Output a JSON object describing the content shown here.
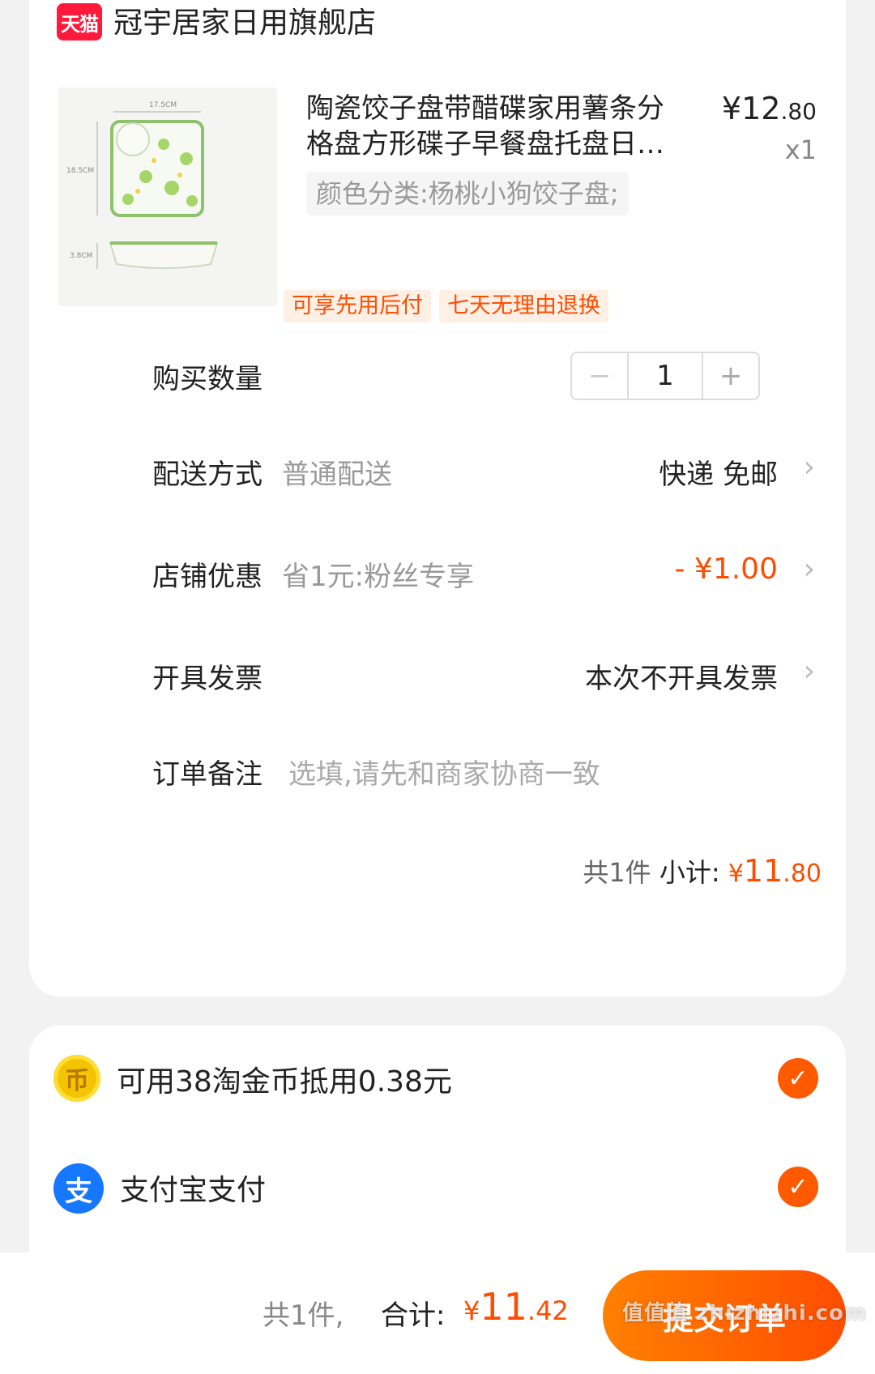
{
  "shop": {
    "platform_logo": "天猫",
    "name": "冠宇居家日用旗舰店",
    "brand_color": "#ff1a3c"
  },
  "product": {
    "image_icon": "ceramic-dumpling-plate-image",
    "image_labels": {
      "width": "17.5CM",
      "height": "18.5CM",
      "depth": "3.8CM"
    },
    "title": "陶瓷饺子盘带醋碟家用薯条分格盘方形碟子早餐盘托盘日…",
    "price_currency": "¥",
    "price_int": "12",
    "price_dec": ".80",
    "quantity": "x1",
    "spec": "颜色分类:杨桃小狗饺子盘;",
    "tags": [
      "可享先用后付",
      "七天无理由退换"
    ]
  },
  "rows": {
    "quantity": {
      "label": "购买数量",
      "value": "1",
      "minus": "−",
      "plus": "+"
    },
    "delivery": {
      "label": "配送方式",
      "value": "普通配送",
      "right": "快递 免邮"
    },
    "discount": {
      "label": "店铺优惠",
      "value": "省1元:粉丝专享",
      "right": "- ¥1.00",
      "color": "#ff4d00"
    },
    "invoice": {
      "label": "开具发票",
      "right": "本次不开具发票"
    },
    "note": {
      "label": "订单备注",
      "placeholder": "选填,请先和商家协商一致"
    }
  },
  "subtotal": {
    "count": "共1件",
    "label": "小计:",
    "currency": "¥",
    "int": "11",
    "dec": ".80"
  },
  "payment": {
    "coins": {
      "icon": "taobao-coin-icon",
      "label": "可用38淘金币抵用0.38元",
      "checked": true
    },
    "alipay": {
      "icon": "alipay-icon",
      "label": "支付宝支付",
      "checked": true
    }
  },
  "footer": {
    "count": "共1件,",
    "total_label": "合计:",
    "currency": "¥",
    "total_int": "11",
    "total_dec": ".42",
    "submit_label": "提交订单",
    "accent": "#ff5a00"
  },
  "watermark": "值值值 zhizhizhi.com"
}
